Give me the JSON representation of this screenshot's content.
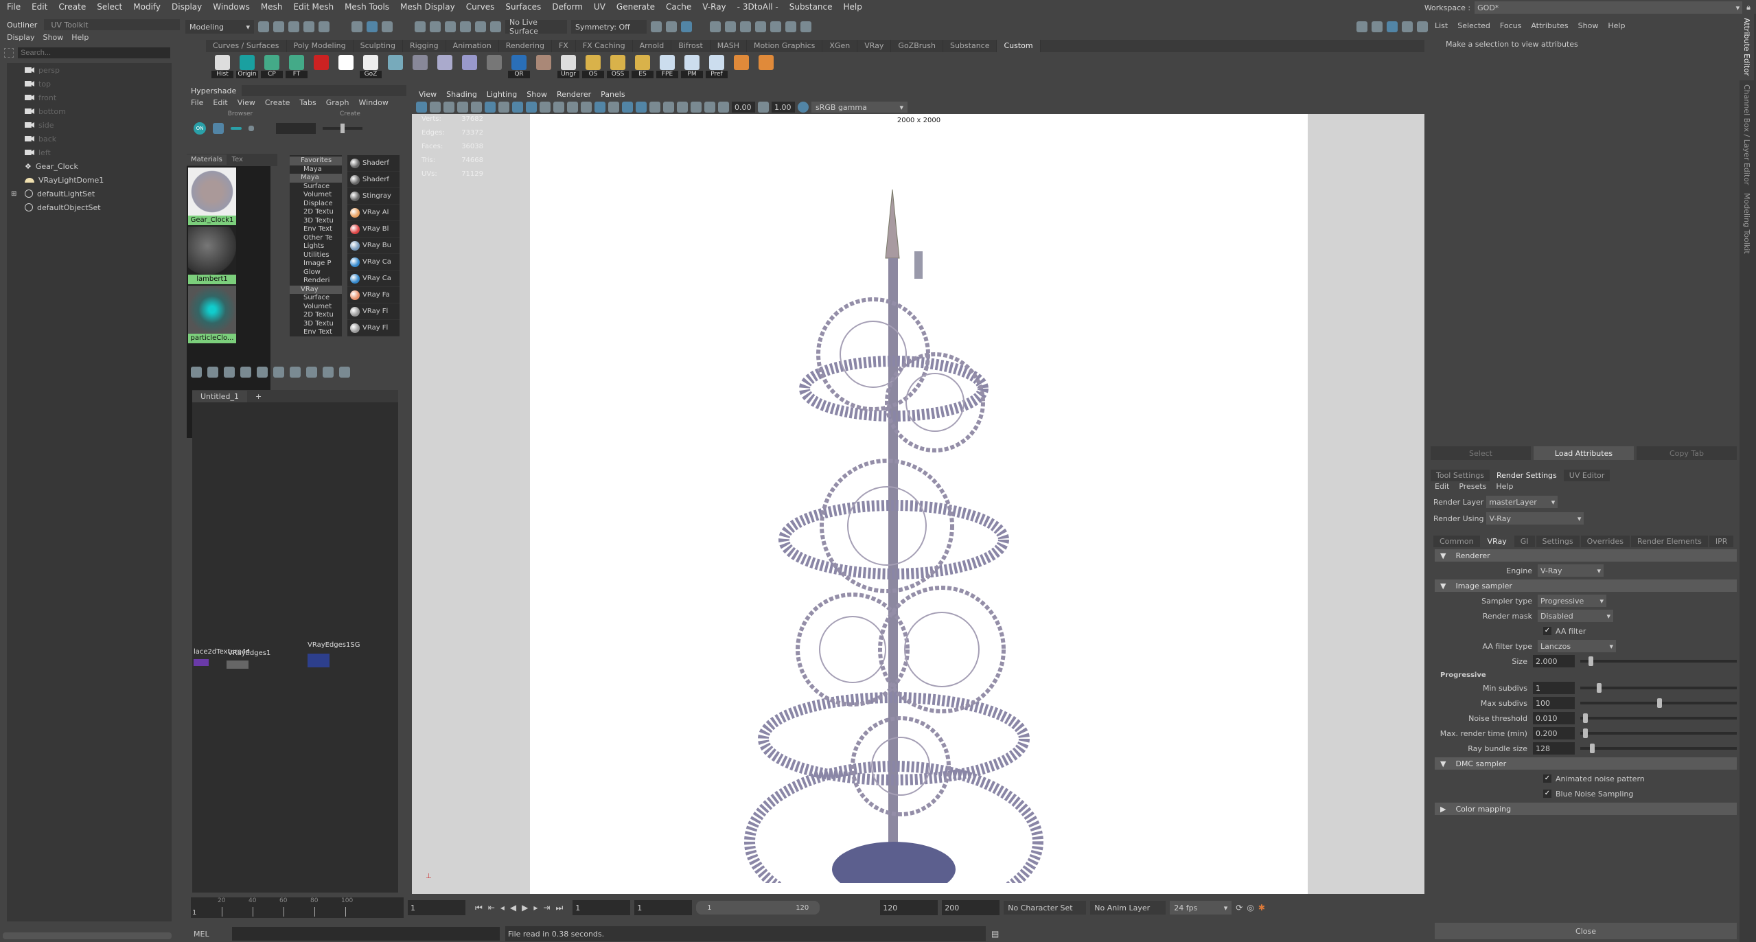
{
  "menubar": [
    "File",
    "Edit",
    "Create",
    "Select",
    "Modify",
    "Display",
    "Windows",
    "Mesh",
    "Edit Mesh",
    "Mesh Tools",
    "Mesh Display",
    "Curves",
    "Surfaces",
    "Deform",
    "UV",
    "Generate",
    "Cache",
    "V-Ray",
    "- 3DtoAll -",
    "Substance",
    "Help"
  ],
  "workspace": {
    "label": "Workspace :",
    "value": "GOD*"
  },
  "statusline": {
    "mode": "Modeling",
    "live_surface": "No Live Surface",
    "symmetry": "Symmetry: Off"
  },
  "shelf": {
    "tabs": [
      "Curves / Surfaces",
      "Poly Modeling",
      "Sculpting",
      "Rigging",
      "Animation",
      "Rendering",
      "FX",
      "FX Caching",
      "Arnold",
      "Bifrost",
      "MASH",
      "Motion Graphics",
      "XGen",
      "VRay",
      "GoZBrush",
      "Substance",
      "Custom"
    ],
    "active_tab": "Custom",
    "buttons": [
      "Hist",
      "Origin",
      "CP",
      "FT",
      "",
      "",
      "GoZ",
      "",
      "",
      "",
      "",
      "",
      "QR",
      "",
      "Ungr",
      "OS",
      "OSS",
      "ES",
      "FPE",
      "PM",
      "Pref",
      "",
      ""
    ]
  },
  "outliner": {
    "tabs": [
      "Outliner",
      "UV Toolkit"
    ],
    "menu": [
      "Display",
      "Show",
      "Help"
    ],
    "search_placeholder": "Search...",
    "items": [
      {
        "label": "persp",
        "type": "camera"
      },
      {
        "label": "top",
        "type": "camera"
      },
      {
        "label": "front",
        "type": "camera"
      },
      {
        "label": "bottom",
        "type": "camera"
      },
      {
        "label": "side",
        "type": "camera"
      },
      {
        "label": "back",
        "type": "camera"
      },
      {
        "label": "left",
        "type": "camera"
      },
      {
        "label": "Gear_Clock",
        "type": "group"
      },
      {
        "label": "VRayLightDome1",
        "type": "light"
      },
      {
        "label": "defaultLightSet",
        "type": "set"
      },
      {
        "label": "defaultObjectSet",
        "type": "set"
      }
    ]
  },
  "hypershade": {
    "title": "Hypershade",
    "menu": [
      "File",
      "Edit",
      "View",
      "Create",
      "Tabs",
      "Graph",
      "Window"
    ],
    "browser_label": "Browser",
    "create_label": "Create",
    "toggle_on": "ON",
    "browser_tabs": [
      "Materials",
      "Tex"
    ],
    "materials": [
      {
        "label": "Gear_Clock1"
      },
      {
        "label": "lambert1"
      },
      {
        "label": "particleClo..."
      }
    ],
    "create_tree": [
      "Favorites",
      "Maya",
      "Maya",
      "Surface",
      "Volumet",
      "Displace",
      "2D Textu",
      "3D Textu",
      "Env Text",
      "Other Te",
      "Lights",
      "Utilities",
      "Image P",
      "Glow",
      "Renderi",
      "VRay",
      "Surface",
      "Volumet",
      "2D Textu",
      "3D Textu",
      "Env Text"
    ],
    "create_list": [
      "Shaderf",
      "Shaderf",
      "Stingray",
      "VRay Al",
      "VRay Bl",
      "VRay Bu",
      "VRay Ca",
      "VRay Ca",
      "VRay Fa",
      "VRay Fl",
      "VRay Fl"
    ],
    "graph_tabs": [
      "Untitled_1",
      "+"
    ],
    "nodes": [
      "lace2dTexture44",
      "VRayEdges1",
      "VRayEdges1SG"
    ]
  },
  "viewport": {
    "menu": [
      "View",
      "Shading",
      "Lighting",
      "Show",
      "Renderer",
      "Panels"
    ],
    "exposure": "0.00",
    "gamma": "1.00",
    "colorspace": "sRGB gamma",
    "resolution": "2000 x 2000",
    "hud": [
      {
        "label": "Verts:",
        "value": "37682"
      },
      {
        "label": "Edges:",
        "value": "73372"
      },
      {
        "label": "Faces:",
        "value": "36038"
      },
      {
        "label": "Tris:",
        "value": "74668"
      },
      {
        "label": "UVs:",
        "value": "71129"
      }
    ]
  },
  "attribute_editor": {
    "menu": [
      "List",
      "Selected",
      "Focus",
      "Attributes",
      "Show",
      "Help"
    ],
    "message": "Make a selection to view attributes",
    "buttons": [
      "Select",
      "Load Attributes",
      "Copy Tab"
    ]
  },
  "side_tabs": [
    "Attribute Editor",
    "Channel Box / Layer Editor",
    "Modeling Toolkit"
  ],
  "render_settings": {
    "tabs": [
      "Tool Settings",
      "Render Settings",
      "UV Editor"
    ],
    "menu": [
      "Edit",
      "Presets",
      "Help"
    ],
    "render_layer_label": "Render Layer",
    "render_layer": "masterLayer",
    "render_using_label": "Render Using",
    "render_using": "V-Ray",
    "sub_tabs": [
      "Common",
      "VRay",
      "GI",
      "Settings",
      "Overrides",
      "Render Elements",
      "IPR"
    ],
    "renderer": {
      "title": "Renderer",
      "engine_label": "Engine",
      "engine": "V-Ray"
    },
    "image_sampler": {
      "title": "Image sampler",
      "sampler_type_label": "Sampler type",
      "sampler_type": "Progressive",
      "render_mask_label": "Render mask",
      "render_mask": "Disabled",
      "aa_filter_label": "AA filter",
      "aa_filter": true,
      "aa_filter_type_label": "AA filter type",
      "aa_filter_type": "Lanczos",
      "size_label": "Size",
      "size": "2.000",
      "progressive_label": "Progressive",
      "min_subdivs_label": "Min subdivs",
      "min_subdivs": "1",
      "max_subdivs_label": "Max subdivs",
      "max_subdivs": "100",
      "noise_threshold_label": "Noise threshold",
      "noise_threshold": "0.010",
      "max_time_label": "Max. render time (min)",
      "max_time": "0.200",
      "ray_bundle_label": "Ray bundle size",
      "ray_bundle": "128"
    },
    "dmc": {
      "title": "DMC sampler",
      "animated_noise_label": "Animated noise pattern",
      "animated_noise": true,
      "blue_noise_label": "Blue Noise Sampling",
      "blue_noise": true
    },
    "color_mapping": "Color mapping",
    "close": "Close"
  },
  "timeline": {
    "ticks": [
      "20",
      "40",
      "60",
      "80",
      "100"
    ],
    "start": "1",
    "current": "1",
    "range_start": "1",
    "range_start2": "1",
    "range_inner_start": "1",
    "range_inner_end": "120",
    "range_end": "120",
    "anim_end": "200",
    "character_set": "No Character Set",
    "anim_layer": "No Anim Layer",
    "fps": "24 fps"
  },
  "cmdline": {
    "label": "MEL",
    "feedback": "File read in  0.38 seconds."
  },
  "colors": {
    "accent": "#5285a6",
    "material_label": "#7ccf7c",
    "vray_logo": "#1f6fd1"
  }
}
